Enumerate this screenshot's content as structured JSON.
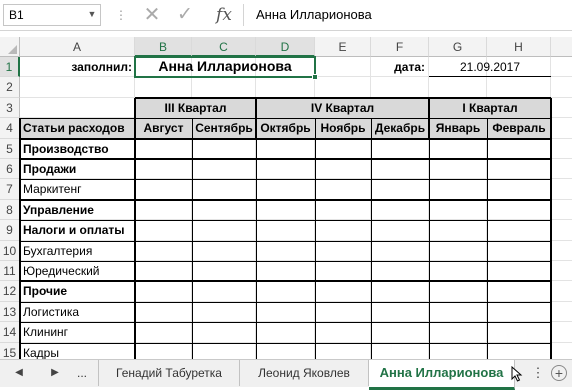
{
  "formula_bar": {
    "name_box": "B1",
    "formula": "Анна Илларионова",
    "fx": "fx"
  },
  "columns": [
    "A",
    "B",
    "C",
    "D",
    "E",
    "F",
    "G",
    "H"
  ],
  "rows": [
    "1",
    "2",
    "3",
    "4",
    "5",
    "6",
    "7",
    "8",
    "9",
    "10",
    "11",
    "12",
    "13",
    "14",
    "15"
  ],
  "sheet": {
    "filled_label": "заполнил:",
    "filled_value": "Анна Илларионова",
    "date_label": "дата:",
    "date_value": "21.09.2017",
    "quarters": [
      "III Квартал",
      "IV Квартал",
      "I Квартал"
    ],
    "header_label": "Статьи расходов",
    "months": [
      "Август",
      "Сентябрь",
      "Октябрь",
      "Ноябрь",
      "Декабрь",
      "Январь",
      "Февраль"
    ],
    "items": [
      {
        "label": "Производство"
      },
      {
        "label": "Продажи"
      },
      {
        "label": "Маркитенг"
      },
      {
        "label": "Управление"
      },
      {
        "label": "Налоги и оплаты"
      },
      {
        "label": "Бухгалтерия"
      },
      {
        "label": "Юредический"
      },
      {
        "label": "Прочие"
      },
      {
        "label": "Логистика"
      },
      {
        "label": "Клининг"
      },
      {
        "label": "Кадры"
      }
    ]
  },
  "tabs": {
    "more": "...",
    "sheets": [
      "Генадий Табуретка",
      "Леонид Яковлев",
      "Анна Илларионова"
    ],
    "active": "Анна Илларионова"
  },
  "colors": {
    "accent": "#217346",
    "header_fill": "#d9d9d9"
  }
}
